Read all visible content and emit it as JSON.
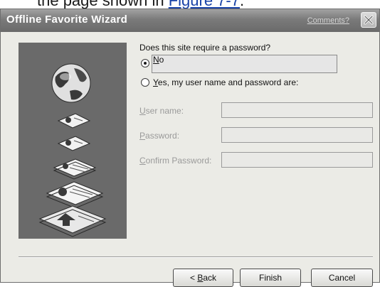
{
  "page": {
    "text_above": "the page shown in",
    "link_above": "Figure 7-7",
    "text_after_link": "."
  },
  "dialog": {
    "title": "Offline Favorite Wizard",
    "title_link": "Comments?",
    "question": "Does this site require a password?",
    "options": [
      {
        "label_accel": "N",
        "label_rest": "o",
        "selected": true
      },
      {
        "label_accel": "Y",
        "label_rest": "es, my user name and password are:",
        "selected": false
      }
    ],
    "fields": [
      {
        "accel": "U",
        "rest": "ser name:",
        "value": ""
      },
      {
        "accel": "P",
        "rest": "assword:",
        "value": ""
      },
      {
        "accel": "C",
        "rest": "onfirm Password:",
        "value": ""
      }
    ],
    "buttons": {
      "back_prefix": "< ",
      "back_accel": "B",
      "back_rest": "ack",
      "finish": "Finish",
      "cancel": "Cancel"
    }
  }
}
